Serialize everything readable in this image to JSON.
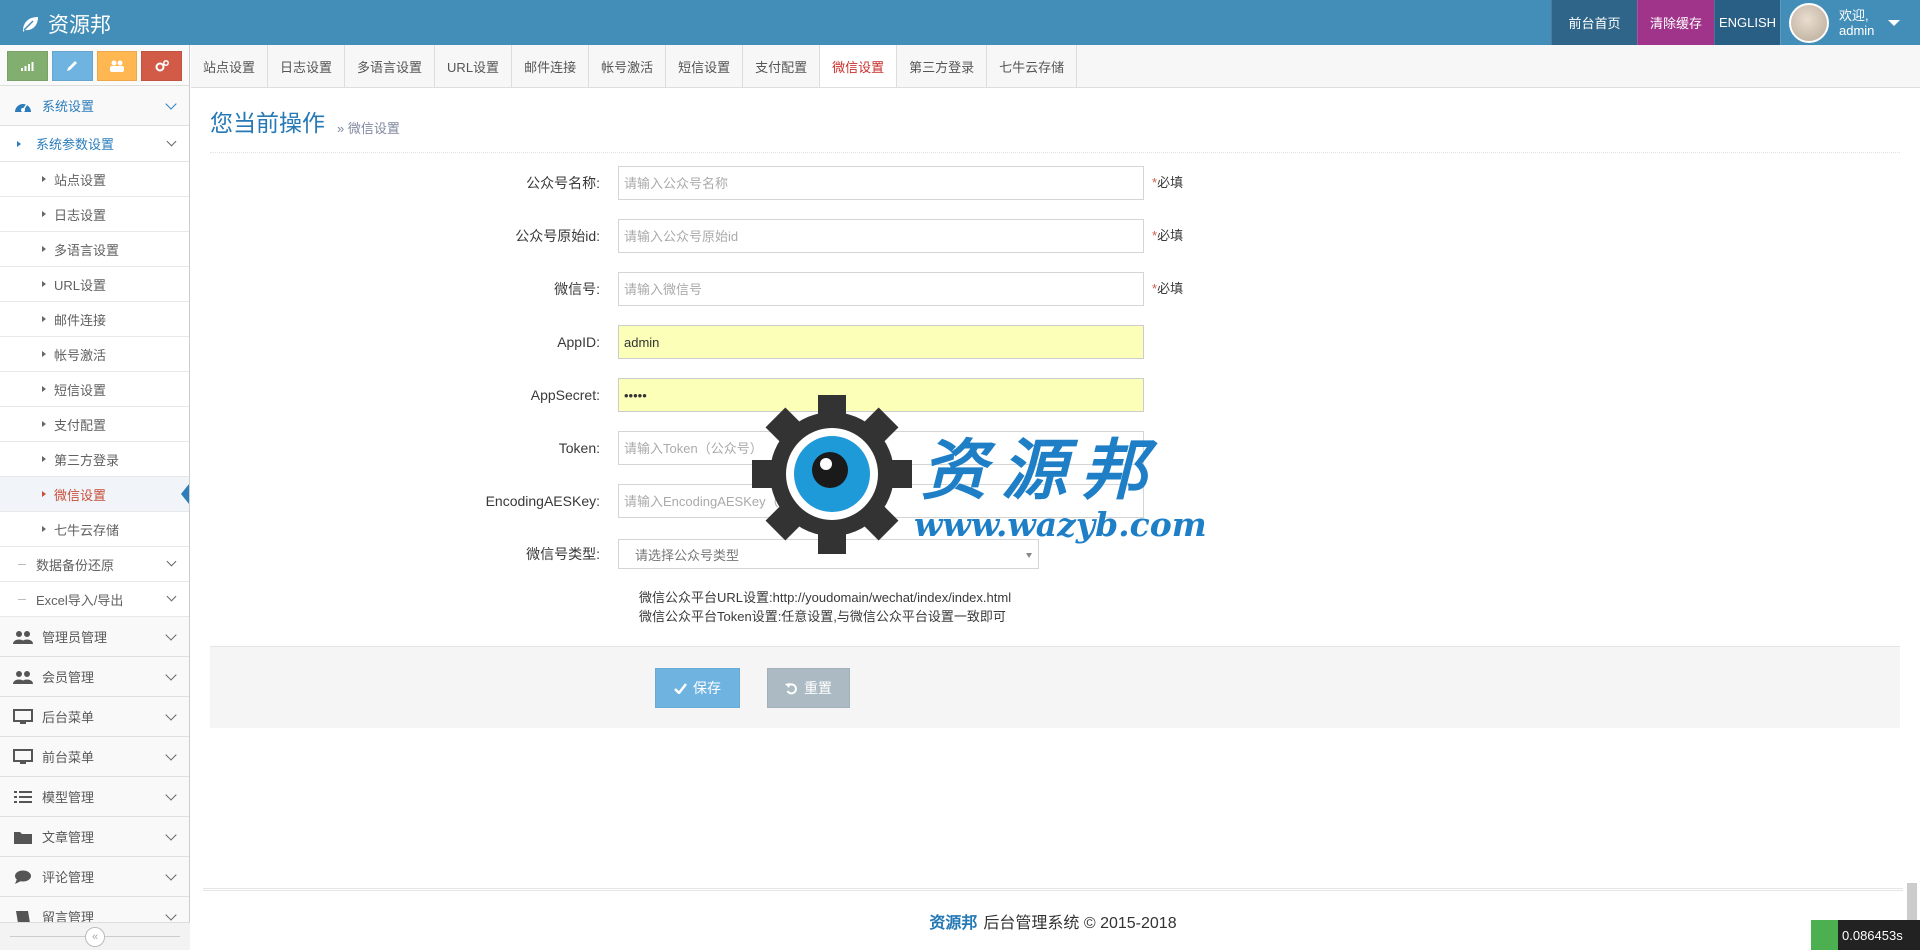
{
  "brand": {
    "name": "资源邦"
  },
  "navbar": {
    "home_link": "前台首页",
    "clear_cache": "清除缓存",
    "language": "ENGLISH",
    "welcome": "欢迎,",
    "username": "admin"
  },
  "sidebar": {
    "system_settings": "系统设置",
    "system_params": "系统参数设置",
    "sub_items": [
      "站点设置",
      "日志设置",
      "多语言设置",
      "URL设置",
      "邮件连接",
      "帐号激活",
      "短信设置",
      "支付配置",
      "第三方登录",
      "微信设置",
      "七牛云存储"
    ],
    "backup": "数据备份还原",
    "excel": "Excel导入/导出",
    "menus": [
      "管理员管理",
      "会员管理",
      "后台菜单",
      "前台菜单",
      "模型管理",
      "文章管理",
      "评论管理",
      "留言管理"
    ]
  },
  "tabs": [
    "站点设置",
    "日志设置",
    "多语言设置",
    "URL设置",
    "邮件连接",
    "帐号激活",
    "短信设置",
    "支付配置",
    "微信设置",
    "第三方登录",
    "七牛云存储"
  ],
  "page": {
    "title": "您当前操作",
    "breadcrumb": "» 微信设置"
  },
  "form": {
    "account_name": {
      "label": "公众号名称:",
      "placeholder": "请输入公众号名称",
      "required": "必填"
    },
    "original_id": {
      "label": "公众号原始id:",
      "placeholder": "请输入公众号原始id",
      "required": "必填"
    },
    "wechat_id": {
      "label": "微信号:",
      "placeholder": "请输入微信号",
      "required": "必填"
    },
    "app_id": {
      "label": "AppID:",
      "value": "admin"
    },
    "app_secret": {
      "label": "AppSecret:",
      "value": "•••••"
    },
    "token": {
      "label": "Token:",
      "placeholder": "请输入Token（公众号）"
    },
    "aes_key": {
      "label": "EncodingAESKey:",
      "placeholder": "请输入EncodingAESKey（公众号）"
    },
    "account_type": {
      "label": "微信号类型:",
      "placeholder": "请选择公众号类型"
    },
    "help_url": "微信公众平台URL设置:http://youdomain/wechat/index/index.html",
    "help_token": "微信公众平台Token设置:任意设置,与微信公众平台设置一致即可",
    "save": "保存",
    "reset": "重置"
  },
  "watermark": {
    "name": "资源邦",
    "url": "www.wazyb.com"
  },
  "footer": {
    "brand": "资源邦",
    "text": "后台管理系统 © 2015-2018"
  },
  "timer": {
    "value": "0.086453s"
  },
  "colors": {
    "navbar": "#438eb9",
    "accent": "#2679b5",
    "active_tab": "#c9302c",
    "save_btn": "#6fb3e0",
    "reset_btn": "#abbac3"
  }
}
